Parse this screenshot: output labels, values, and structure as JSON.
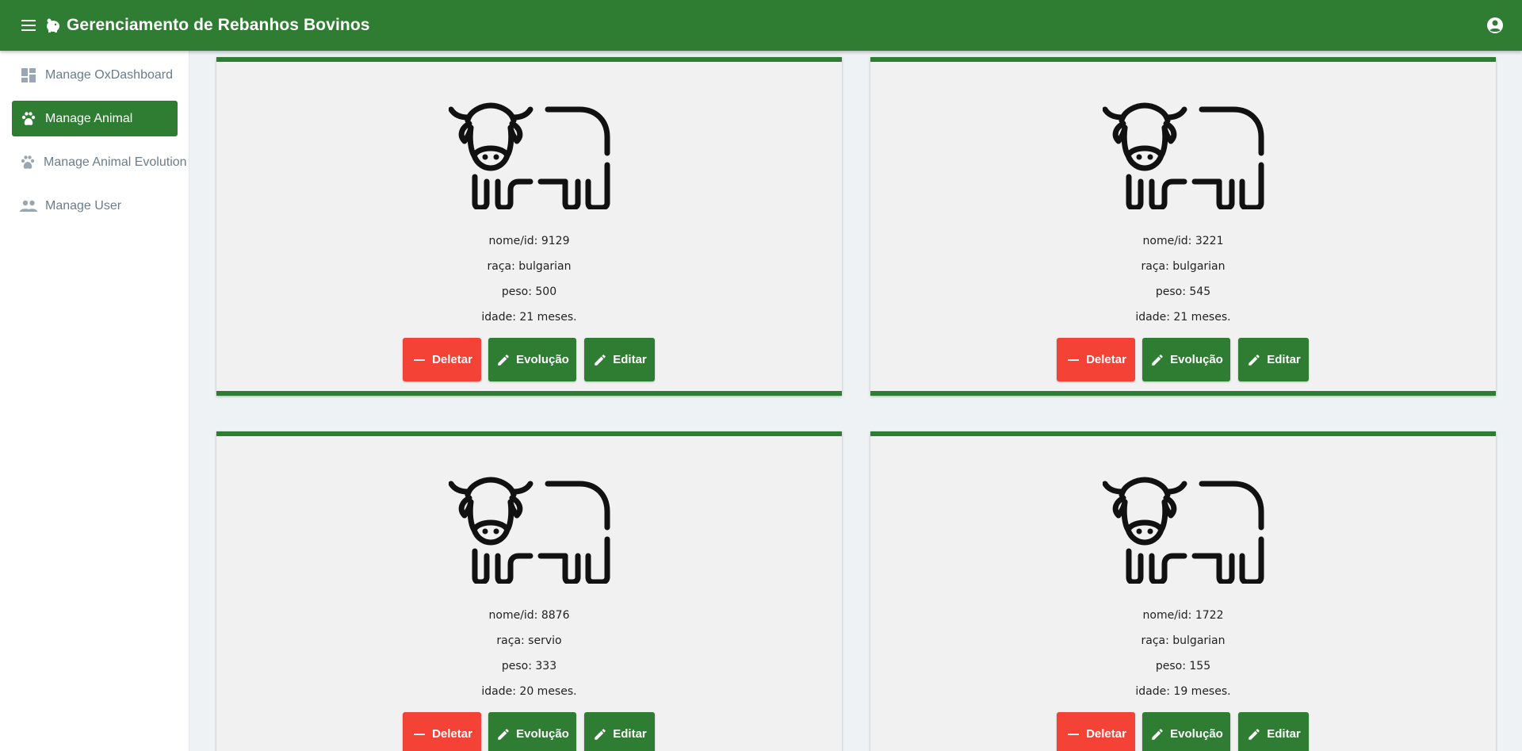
{
  "header": {
    "title": "Gerenciamento de Rebanhos Bovinos"
  },
  "sidebar": {
    "items": [
      {
        "label": "Manage OxDashboard",
        "icon": "dashboard-icon",
        "active": false
      },
      {
        "label": "Manage Animal",
        "icon": "paw-icon",
        "active": true
      },
      {
        "label": "Manage Animal Evolution",
        "icon": "paw-icon",
        "active": false
      },
      {
        "label": "Manage User",
        "icon": "people-icon",
        "active": false
      }
    ]
  },
  "colors": {
    "primary": "#2e7d32",
    "danger": "#f44336",
    "card_bg": "#f1f1f1",
    "page_bg": "#eef2f5"
  },
  "buttons": {
    "delete": "Deletar",
    "evolution": "Evolução",
    "edit": "Editar"
  },
  "animals": [
    {
      "nome": "nome/id: 9129",
      "raca": "raça: bulgarian",
      "peso": "peso: 500",
      "idade": "idade: 21 meses."
    },
    {
      "nome": "nome/id: 3221",
      "raca": "raça: bulgarian",
      "peso": "peso: 545",
      "idade": "idade: 21 meses."
    },
    {
      "nome": "nome/id: 8876",
      "raca": "raça: servio",
      "peso": "peso: 333",
      "idade": "idade: 20 meses."
    },
    {
      "nome": "nome/id: 1722",
      "raca": "raça: bulgarian",
      "peso": "peso: 155",
      "idade": "idade: 19 meses."
    }
  ]
}
